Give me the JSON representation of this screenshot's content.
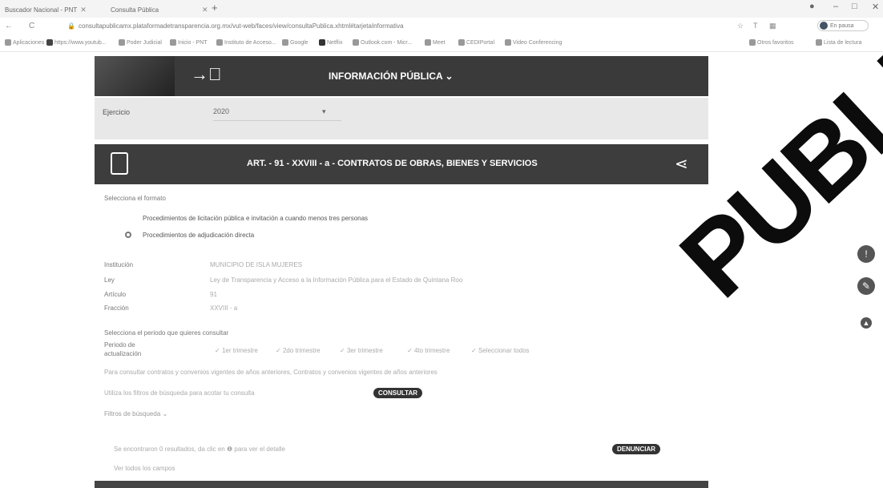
{
  "browser": {
    "tabs": [
      {
        "label": "Buscador Nacional - PNT"
      },
      {
        "label": "Consulta Pública"
      }
    ],
    "new_tab": "+",
    "url": "consultapublicamx.plataformadetransparencia.org.mx/vut-web/faces/view/consultaPublica.xhtml#tarjetaInformativa",
    "profile_label": "En pausa",
    "bookmarks": [
      "Aplicaciones",
      "https://www.youtub...",
      "Poder Judicial",
      "Inicio - PNT",
      "Instituto de Acceso...",
      "Google",
      "Netflix",
      "Outlook.com - Micr...",
      "Meet",
      "CEDIPortal",
      "Video Conferencing"
    ],
    "bookmarks_right": [
      "Otros favoritos",
      "Lista de lectura"
    ]
  },
  "header": {
    "title": "INFORMACIÓN PÚBLICA ⌄"
  },
  "filter": {
    "ejercicio_label": "Ejercicio",
    "ejercicio_value": "2020"
  },
  "article": {
    "title": "ART. - 91 - XXVIII - a - CONTRATOS DE OBRAS, BIENES Y SERVICIOS"
  },
  "formato": {
    "prompt": "Selecciona el formato",
    "option1": "Procedimientos de licitación pública e invitación a cuando menos tres personas",
    "option2": "Procedimientos de adjudicación directa"
  },
  "info": {
    "institucion_label": "Institución",
    "institucion_value": "MUNICIPIO DE ISLA MUJERES",
    "ley_label": "Ley",
    "ley_value": "Ley de Transparencia y Acceso a la Información Pública para el Estado de Quintana Roo",
    "articulo_label": "Artículo",
    "articulo_value": "91",
    "fraccion_label": "Fracción",
    "fraccion_value": "XXVIII - a"
  },
  "periodo": {
    "prompt": "Selecciona el periodo que quieres consultar",
    "label": "Periodo de actualización",
    "options": [
      "1er trimestre",
      "2do trimestre",
      "3er trimestre",
      "4to trimestre",
      "Seleccionar todos"
    ],
    "note": "Para consultar contratos y convenios vigentes de años anteriores, Contratos y convenios vigentes de años anteriores"
  },
  "consulta": {
    "prompt": "Utiliza los filtros de búsqueda para acotar tu consulta",
    "button": "CONSULTAR",
    "filtros": "Filtros de búsqueda ⌄"
  },
  "results": {
    "text": "Se encontraron 0 resultados, da clic en ❶ para ver el detalle",
    "denunciar": "DENUNCIAR",
    "ver_campos": "Ver todos los campos"
  },
  "watermark": "PUBLICA"
}
